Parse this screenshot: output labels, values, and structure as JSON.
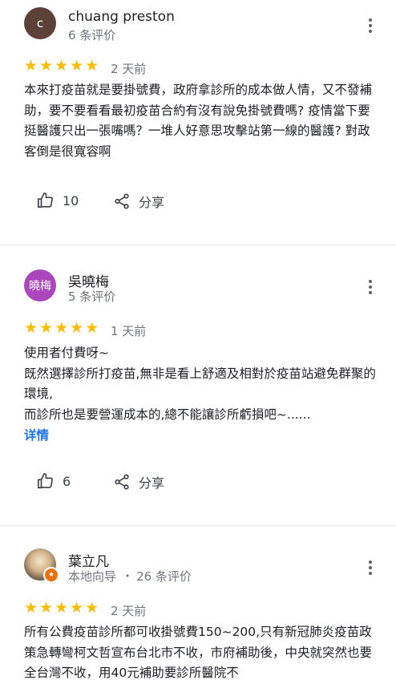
{
  "reviews": [
    {
      "name": "chuang preston",
      "avatar_letter": "c",
      "avatar_color": "#5d4037",
      "sub": "6 条评价",
      "stars": "★★★★★",
      "rating": 5,
      "date": "2 天前",
      "text": "本來打疫苗就是要掛號費，政府拿診所的成本做人情，又不發補助，要不要看看最初疫苗合約有沒有說免掛號費嗎? 疫情當下要挺醫護只出一張嘴嗎？一堆人好意思攻擊站第一線的醫護? 對政客倒是很寬容啊",
      "likes": "10",
      "share_label": "分享"
    },
    {
      "name": "吳曉梅",
      "avatar_letter": "曉梅",
      "avatar_color": "#ab47bc",
      "sub": "5 条评价",
      "stars": "★★★★★",
      "rating": 5,
      "date": "1 天前",
      "text": "使用者付費呀~\n既然選擇診所打疫苗,無非是看上舒適及相對於疫苗站避免群聚的環境,\n而診所也是要營運成本的,總不能讓診所虧損吧~......",
      "more_label": "详情",
      "likes": "6",
      "share_label": "分享"
    },
    {
      "name": "葉立凡",
      "sub_guide": "本地向导",
      "sub_count": "26 条评价",
      "stars": "★★★★★",
      "rating": 5,
      "date": "2 天前",
      "text": "所有公費疫苗診所都可收掛號費150~200,只有新冠肺炎疫苗政策急轉彎柯文哲宣布台北市不收，市府補助後，中央就突然也要全台灣不收，用40元補助要診所醫院不"
    }
  ],
  "separator": "•",
  "colors": {
    "star": "#fbbc04",
    "link": "#1a73e8",
    "secondary_text": "#70757a"
  }
}
